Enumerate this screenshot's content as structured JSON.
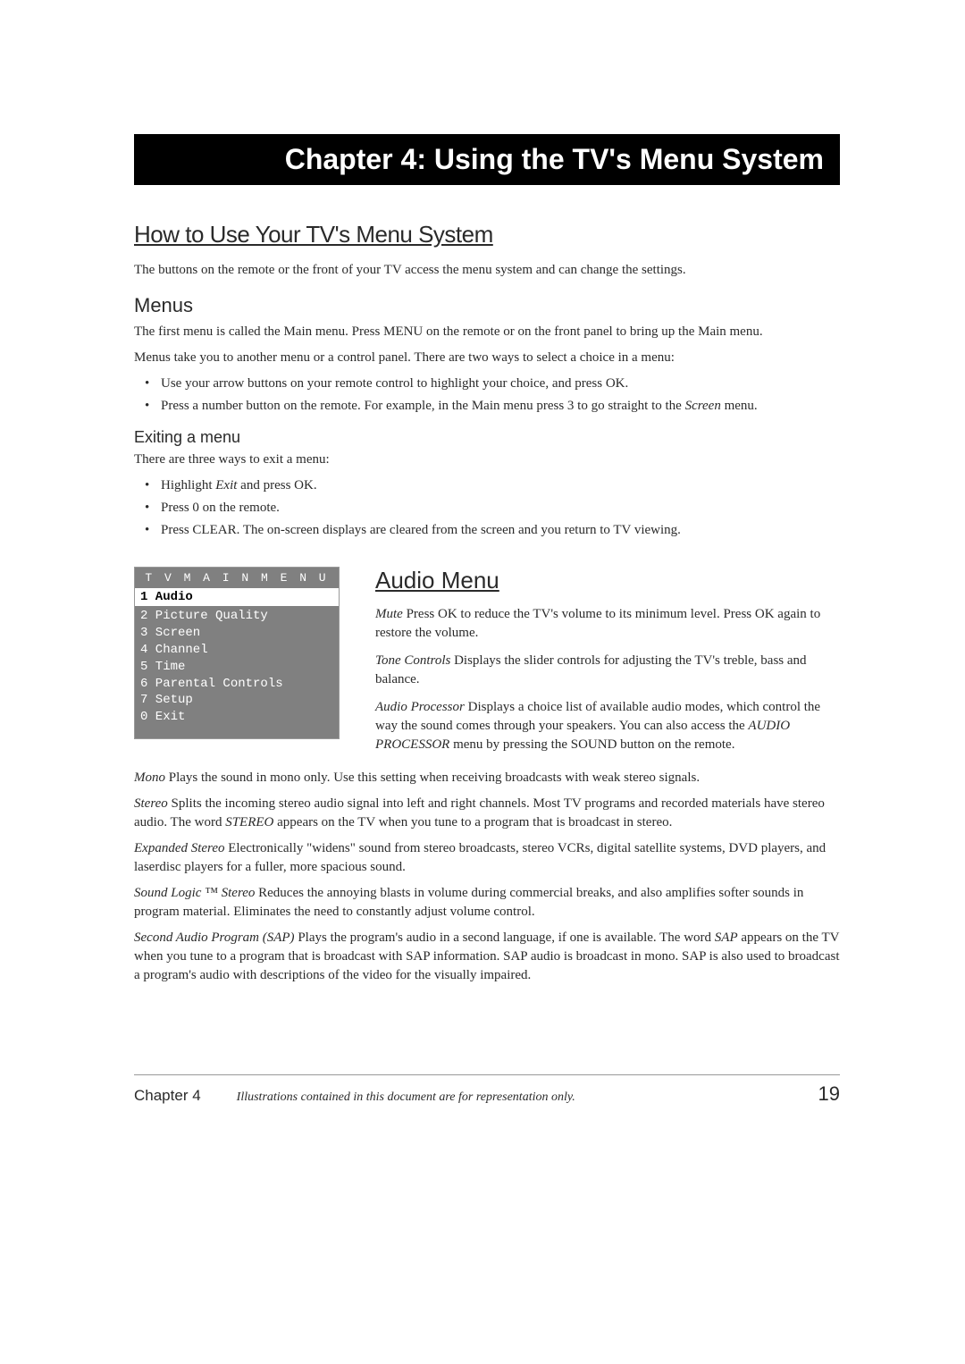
{
  "chapter_bar": "Chapter 4: Using the TV's Menu System",
  "section1_title": "How to Use Your TV's Menu System",
  "section1_intro": "The buttons on the remote or the front of your TV access the menu system and can change the settings.",
  "menus_heading": "Menus",
  "menus_p1": "The first menu is called the Main menu. Press MENU on the remote or on the front panel to bring up the Main menu.",
  "menus_p2": "Menus take you to another menu or a control panel. There are two ways to select a choice in a menu:",
  "menus_bullets": [
    "Use your arrow buttons on your remote control to highlight your choice, and press OK.",
    "Press a number button on the remote. For example, in the Main menu press 3 to go straight to the Screen menu."
  ],
  "exiting_heading": "Exiting a menu",
  "exiting_intro": "There are three ways to exit a menu:",
  "exiting_bullets": [
    "Highlight Exit and press OK.",
    "Press 0 on the remote.",
    "Press CLEAR. The on-screen displays are cleared from the screen and you return to TV viewing."
  ],
  "tv_menu": {
    "title": "T V   M A I N   M E N U",
    "selected": "1 Audio",
    "items": [
      "2 Picture Quality",
      "3 Screen",
      "4 Channel",
      "5 Time",
      "6 Parental Controls",
      "7 Setup",
      "0 Exit"
    ]
  },
  "audio_heading": "Audio Menu",
  "audio_entries_right": [
    {
      "term": "Mute",
      "desc": "   Press OK to reduce the TV's volume to its minimum level. Press OK again to restore the volume."
    },
    {
      "term": "Tone Controls",
      "desc": "    Displays the slider controls for adjusting the TV's treble, bass and balance."
    },
    {
      "term": "Audio Processor",
      "desc": "    Displays a choice list of available audio modes, which control the way the sound comes through your speakers. You can also access the AUDIO PROCESSOR menu by pressing the SOUND button on the remote."
    }
  ],
  "audio_entries_full": [
    {
      "term": "Mono",
      "desc": "   Plays the sound in mono only. Use this setting when receiving broadcasts with weak stereo signals."
    },
    {
      "term": "Stereo",
      "desc": "   Splits the incoming stereo audio signal into left and right channels. Most TV programs and recorded materials have stereo audio. The word STEREO appears on the TV when you tune to a program that is broadcast in stereo."
    },
    {
      "term": "Expanded Stereo",
      "desc": "    Electronically \"widens\" sound from stereo broadcasts, stereo VCRs, digital satellite systems, DVD players, and laserdisc players for a fuller, more spacious sound."
    },
    {
      "term": "Sound Logic ™ Stereo",
      "desc": "   Reduces the annoying blasts in volume during commercial breaks, and also amplifies softer sounds in program material. Eliminates the need to constantly adjust volume control."
    },
    {
      "term": "Second Audio Program (SAP)",
      "desc": "    Plays the program's audio in a second language, if one is available. The word SAP appears on the TV when you tune to a program that is broadcast with SAP information. SAP audio is broadcast in mono. SAP is also used to broadcast a program's audio with descriptions of the video for the visually impaired."
    }
  ],
  "footer": {
    "chapter": "Chapter 4",
    "note": "Illustrations contained in this document are for representation only.",
    "page": "19"
  }
}
